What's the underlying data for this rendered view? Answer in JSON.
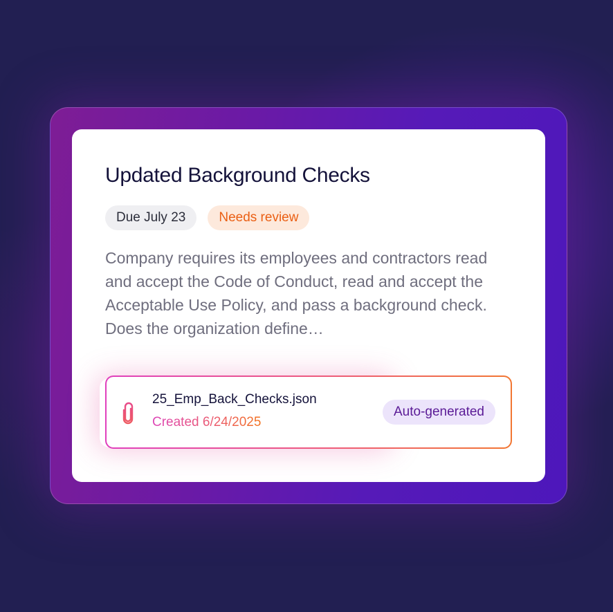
{
  "task": {
    "title": "Updated Background Checks",
    "due_label": "Due July 23",
    "status_label": "Needs review",
    "description": "Company requires its employees and contractors read and accept the Code of Conduct, read and accept the Acceptable Use Policy, and pass a background check. Does the organization define…"
  },
  "attachment": {
    "icon": "paperclip-icon",
    "file_name": "25_Emp_Back_Checks.json",
    "created": "Created 6/24/2025",
    "badge": "Auto-generated"
  },
  "colors": {
    "background": "#221f52",
    "frame_start": "#7e1d95",
    "frame_end": "#4d17bb",
    "status_text": "#ea5f14",
    "status_bg": "#fde9dc",
    "auto_badge_text": "#5a1a96",
    "auto_badge_bg": "#ece4fb",
    "accent_pink": "#e03fbd",
    "accent_orange": "#f27631"
  }
}
